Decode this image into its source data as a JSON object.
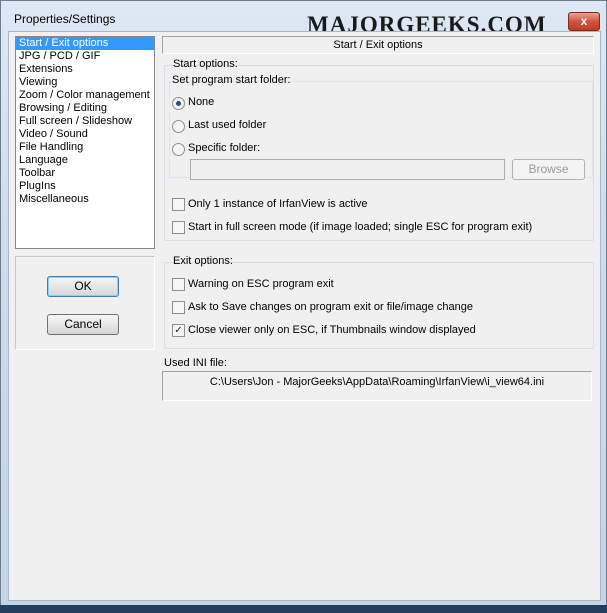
{
  "window": {
    "title": "Properties/Settings",
    "watermark": "MAJORGEEKS.COM",
    "close_glyph": "x"
  },
  "pages": [
    "Start / Exit options",
    "JPG / PCD / GIF",
    "Extensions",
    "Viewing",
    "Zoom / Color management",
    "Browsing / Editing",
    "Full screen / Slideshow",
    "Video / Sound",
    "File Handling",
    "Language",
    "Toolbar",
    "PlugIns",
    "Miscellaneous"
  ],
  "selected_page": "Start / Exit options",
  "buttons": {
    "ok": "OK",
    "cancel": "Cancel",
    "browse": "Browse"
  },
  "panel": {
    "header": "Start / Exit options",
    "start_options": {
      "title": "Start options:",
      "folder_title": "Set program start folder:",
      "radios": [
        {
          "label": "None",
          "checked": true
        },
        {
          "label": "Last used folder",
          "checked": false
        },
        {
          "label": "Specific folder:",
          "checked": false
        }
      ],
      "folder_value": "",
      "checks": [
        {
          "label": "Only 1 instance of IrfanView is active",
          "checked": false
        },
        {
          "label": "Start in full screen mode (if image loaded; single ESC for program exit)",
          "checked": false
        }
      ]
    },
    "exit_options": {
      "title": "Exit options:",
      "checks": [
        {
          "label": "Warning on ESC program exit",
          "checked": false
        },
        {
          "label": "Ask to Save changes on program exit or file/image change",
          "checked": false
        },
        {
          "label": "Close viewer only on ESC, if Thumbnails window displayed",
          "checked": true
        }
      ]
    },
    "ini": {
      "label": "Used INI file:",
      "path": "C:\\Users\\Jon - MajorGeeks\\AppData\\Roaming\\IrfanView\\i_view64.ini"
    }
  },
  "icons": {
    "checkmark": "check-icon",
    "radio_dot": "radio-dot-icon",
    "close": "close-icon"
  }
}
